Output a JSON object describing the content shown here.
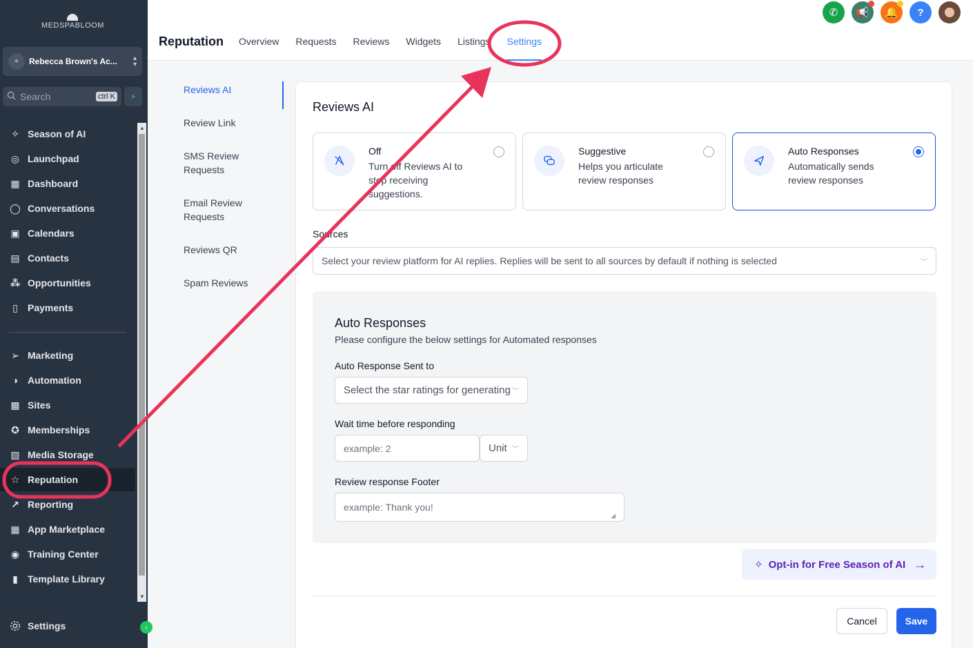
{
  "brand": {
    "logo_text": "MEDSPABLOOM"
  },
  "account": {
    "name": "Rebecca Brown's Ac...",
    "icon": "location-icon"
  },
  "search": {
    "label": "Search",
    "shortcut": "ctrl K"
  },
  "sidebar": {
    "items": [
      {
        "label": "Season of AI",
        "icon": "sparkle-icon"
      },
      {
        "label": "Launchpad",
        "icon": "rocket-icon"
      },
      {
        "label": "Dashboard",
        "icon": "grid-icon"
      },
      {
        "label": "Conversations",
        "icon": "chat-icon"
      },
      {
        "label": "Calendars",
        "icon": "calendar-icon"
      },
      {
        "label": "Contacts",
        "icon": "contacts-icon"
      },
      {
        "label": "Opportunities",
        "icon": "opportunities-icon"
      },
      {
        "label": "Payments",
        "icon": "payments-icon"
      },
      {
        "label": "Marketing",
        "icon": "send-icon"
      },
      {
        "label": "Automation",
        "icon": "automation-icon"
      },
      {
        "label": "Sites",
        "icon": "sites-icon"
      },
      {
        "label": "Memberships",
        "icon": "award-icon"
      },
      {
        "label": "Media Storage",
        "icon": "image-icon"
      },
      {
        "label": "Reputation",
        "icon": "star-icon"
      },
      {
        "label": "Reporting",
        "icon": "trend-icon"
      },
      {
        "label": "App Marketplace",
        "icon": "apps-icon"
      },
      {
        "label": "Training Center",
        "icon": "training-icon"
      },
      {
        "label": "Template Library",
        "icon": "template-icon"
      }
    ],
    "settings_label": "Settings"
  },
  "header": {
    "title": "Reputation",
    "tabs": [
      "Overview",
      "Requests",
      "Reviews",
      "Widgets",
      "Listings",
      "Settings"
    ],
    "active_tab": "Settings"
  },
  "subnav": {
    "items": [
      "Reviews AI",
      "Review Link",
      "SMS Review Requests",
      "Email Review Requests",
      "Reviews QR",
      "Spam Reviews"
    ]
  },
  "reviews_ai": {
    "title": "Reviews AI",
    "options": [
      {
        "title": "Off",
        "desc": "Turn off Reviews AI to stop receiving suggestions.",
        "icon": "ai-off-icon",
        "selected": false
      },
      {
        "title": "Suggestive",
        "desc": "Helps you articulate review responses",
        "icon": "chat-bubbles-icon",
        "selected": false
      },
      {
        "title": "Auto Responses",
        "desc": "Automatically sends review responses",
        "icon": "paper-plane-icon",
        "selected": true
      }
    ],
    "sources_label": "Sources",
    "sources_placeholder": "Select your review platform for AI replies. Replies will be sent to all sources by default if nothing is selected"
  },
  "auto_responses": {
    "title": "Auto Responses",
    "subtitle": "Please configure the below settings for Automated responses",
    "sent_to_label": "Auto Response Sent to",
    "sent_to_placeholder": "Select the star ratings for generating",
    "wait_label": "Wait time before responding",
    "wait_placeholder": "example: 2",
    "unit_label": "Unit",
    "footer_label": "Review response Footer",
    "footer_placeholder": "example: Thank you!"
  },
  "optin": {
    "label": "Opt-in for Free Season of AI"
  },
  "actions": {
    "cancel": "Cancel",
    "save": "Save"
  },
  "colors": {
    "accent": "#2563eb",
    "sidebar": "#283342",
    "annotation": "#e8345a"
  }
}
